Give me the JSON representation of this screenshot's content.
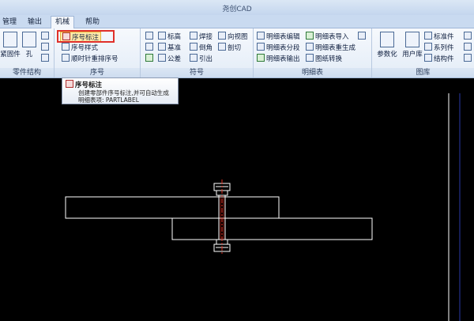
{
  "window": {
    "title": "尧创CAD"
  },
  "tabs": [
    {
      "label": "管理"
    },
    {
      "label": "输出"
    },
    {
      "label": "机械"
    },
    {
      "label": "帮助"
    }
  ],
  "groups": {
    "part_structure": {
      "label": "零件结构",
      "items": [
        "紧固件",
        "孔"
      ]
    },
    "sequence": {
      "label": "序号",
      "items": [
        "序号标注",
        "序号样式",
        "顺时针重排序号"
      ]
    },
    "symbol": {
      "label": "符号",
      "items": [
        "标高",
        "焊接",
        "向视图",
        "基准",
        "倒角",
        "剖切",
        "公差",
        "引出"
      ]
    },
    "bom": {
      "label": "明细表",
      "items": [
        "明细表编辑",
        "明细表导入",
        "明细表分段",
        "明细表重生成",
        "明细表输出",
        "图纸转换"
      ]
    },
    "library": {
      "label": "图库",
      "items": [
        "参数化",
        "用户库",
        "标准件",
        "系列件",
        "结构件"
      ]
    }
  },
  "tooltip": {
    "title": "序号标注",
    "line1": "创建零部件序号标注,并可自动生成",
    "line2": "明细表项: PARTLABEL"
  },
  "colors": {
    "accent": "#e0302a",
    "canvas": "#000000"
  }
}
